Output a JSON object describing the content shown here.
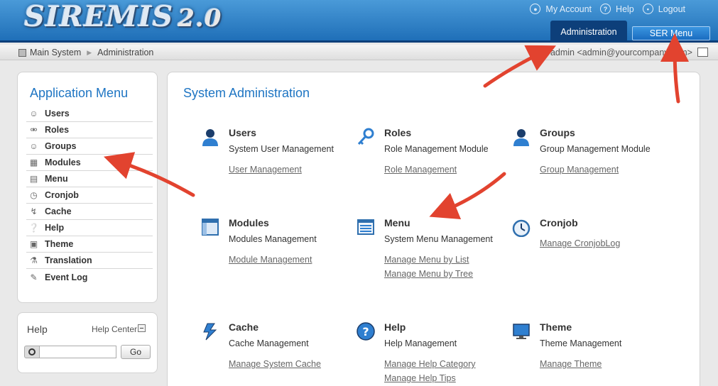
{
  "header": {
    "logo_text": "SIREMIS",
    "logo_version": "2.0",
    "links": [
      {
        "label": "My Account",
        "icon": "user-icon"
      },
      {
        "label": "Help",
        "icon": "question-icon"
      },
      {
        "label": "Logout",
        "icon": "power-icon"
      }
    ],
    "tabs": [
      {
        "label": "Administration",
        "active": true
      },
      {
        "label": "SER Menu",
        "active": false
      }
    ]
  },
  "breadcrumb": {
    "items": [
      "Main System",
      "Administration"
    ],
    "user": "admin <admin@yourcompany.com>"
  },
  "app_menu": {
    "title": "Application Menu",
    "items": [
      {
        "label": "Users",
        "icon": "user-icon"
      },
      {
        "label": "Roles",
        "icon": "key-icon"
      },
      {
        "label": "Groups",
        "icon": "group-icon"
      },
      {
        "label": "Modules",
        "icon": "module-icon"
      },
      {
        "label": "Menu",
        "icon": "menu-icon"
      },
      {
        "label": "Cronjob",
        "icon": "clock-icon"
      },
      {
        "label": "Cache",
        "icon": "cache-icon"
      },
      {
        "label": "Help",
        "icon": "help-icon"
      },
      {
        "label": "Theme",
        "icon": "monitor-icon"
      },
      {
        "label": "Translation",
        "icon": "translation-icon"
      },
      {
        "label": "Event Log",
        "icon": "log-icon"
      }
    ]
  },
  "help_box": {
    "title": "Help",
    "center_label": "Help Center",
    "search_value": "",
    "go_label": "Go"
  },
  "main": {
    "title": "System Administration",
    "modules": [
      {
        "name": "Users",
        "desc": "System User Management",
        "links": [
          "User Management"
        ]
      },
      {
        "name": "Roles",
        "desc": "Role Management Module",
        "links": [
          "Role Management"
        ]
      },
      {
        "name": "Groups",
        "desc": "Group Management Module",
        "links": [
          "Group Management"
        ]
      },
      {
        "name": "Modules",
        "desc": "Modules Management",
        "links": [
          "Module Management"
        ]
      },
      {
        "name": "Menu",
        "desc": "System Menu Management",
        "links": [
          "Manage Menu by List",
          "Manage Menu by Tree"
        ]
      },
      {
        "name": "Cronjob",
        "desc": "",
        "links": [
          "Manage CronjobLog"
        ]
      },
      {
        "name": "Cache",
        "desc": "Cache Management",
        "links": [
          "Manage System Cache"
        ]
      },
      {
        "name": "Help",
        "desc": "Help Management",
        "links": [
          "Manage Help Category",
          "Manage Help Tips"
        ]
      },
      {
        "name": "Theme",
        "desc": "Theme Management",
        "links": [
          "Manage Theme"
        ]
      }
    ]
  },
  "colors": {
    "accent": "#1e75c3",
    "header_dark": "#0d3f7a",
    "annotation_arrow": "#e2432f"
  }
}
